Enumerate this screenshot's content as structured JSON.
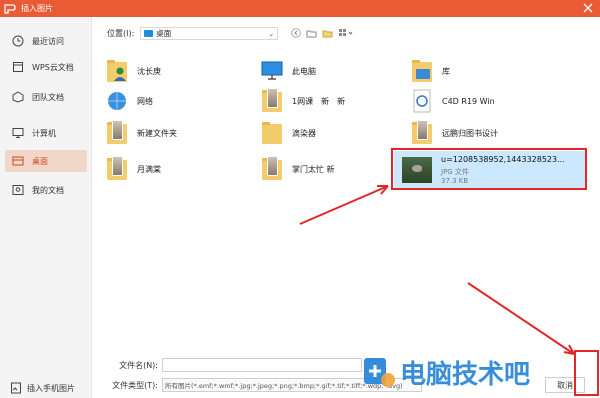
{
  "window": {
    "title": "插入图片"
  },
  "sidebar": {
    "items": [
      {
        "label": "最近访问",
        "icon": "clock-icon"
      },
      {
        "label": "WPS云文档",
        "icon": "cloud-docs-icon"
      },
      {
        "label": "团队文档",
        "icon": "team-docs-icon"
      },
      {
        "label": "计算机",
        "icon": "computer-icon"
      },
      {
        "label": "桌面",
        "icon": "desktop-icon",
        "active": true
      },
      {
        "label": "我的文档",
        "icon": "my-docs-icon"
      }
    ],
    "bottom": {
      "label": "插入手机图片",
      "icon": "phone-image-icon"
    }
  },
  "location": {
    "label": "位置(I):",
    "value": "桌面"
  },
  "files": [
    {
      "name": "沈长庚",
      "icon": "user-folder-icon"
    },
    {
      "name": "此电脑",
      "icon": "this-pc-icon"
    },
    {
      "name": "库",
      "icon": "library-icon"
    },
    {
      "name": "网络",
      "icon": "network-icon"
    },
    {
      "name": "1网课　新　新",
      "icon": "folder-thumb-icon"
    },
    {
      "name": "C4D R19 Win",
      "icon": "c4d-icon"
    },
    {
      "name": "新建文件夹",
      "icon": "folder-thumb-icon"
    },
    {
      "name": "滴染器",
      "icon": "folder-icon"
    },
    {
      "name": "远鹏归图书设计",
      "icon": "folder-thumb-icon"
    },
    {
      "name": "月满棠",
      "icon": "folder-thumb-icon"
    },
    {
      "name": "掌门太忙 新",
      "icon": "folder-thumb-icon"
    }
  ],
  "selected_file": {
    "name": "u=1208538952,1443328523...",
    "type": "JPG 文件",
    "size": "37.3 KB"
  },
  "footer": {
    "filename_label": "文件名(N):",
    "filename_value": "",
    "filetype_label": "文件类型(T):",
    "filetype_value": "所有图片(*.emf;*.wmf;*.jpg;*.jpeg;*.png;*.bmp;*.gif;*.tif;*.tiff;*.wdp;*.svg)",
    "cancel_label": "取消"
  },
  "watermark": {
    "text": "电脑技术吧"
  },
  "colors": {
    "accent": "#ea5b35",
    "highlight": "#e12727",
    "selection": "#cce8ff"
  }
}
